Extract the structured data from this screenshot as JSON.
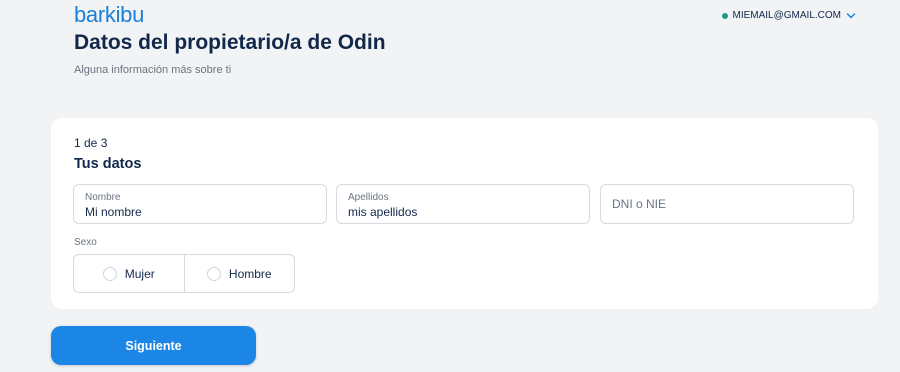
{
  "header": {
    "logo_text": "barkibu",
    "account_email": "MIEMAIL@GMAIL.COM",
    "status_color": "#1e9a8a"
  },
  "page": {
    "title": "Datos del propietario/a de Odin",
    "subtitle": "Alguna información más sobre ti"
  },
  "form": {
    "step": "1 de 3",
    "section_title": "Tus datos",
    "fields": {
      "nombre": {
        "label": "Nombre",
        "value": "Mi nombre"
      },
      "apellidos": {
        "label": "Apellidos",
        "value": "mis apellidos"
      },
      "dni": {
        "placeholder": "DNI o NIE",
        "value": ""
      }
    },
    "sexo": {
      "label": "Sexo",
      "options": [
        "Mujer",
        "Hombre"
      ]
    }
  },
  "actions": {
    "next_label": "Siguiente",
    "accent_color": "#1b86e6"
  }
}
